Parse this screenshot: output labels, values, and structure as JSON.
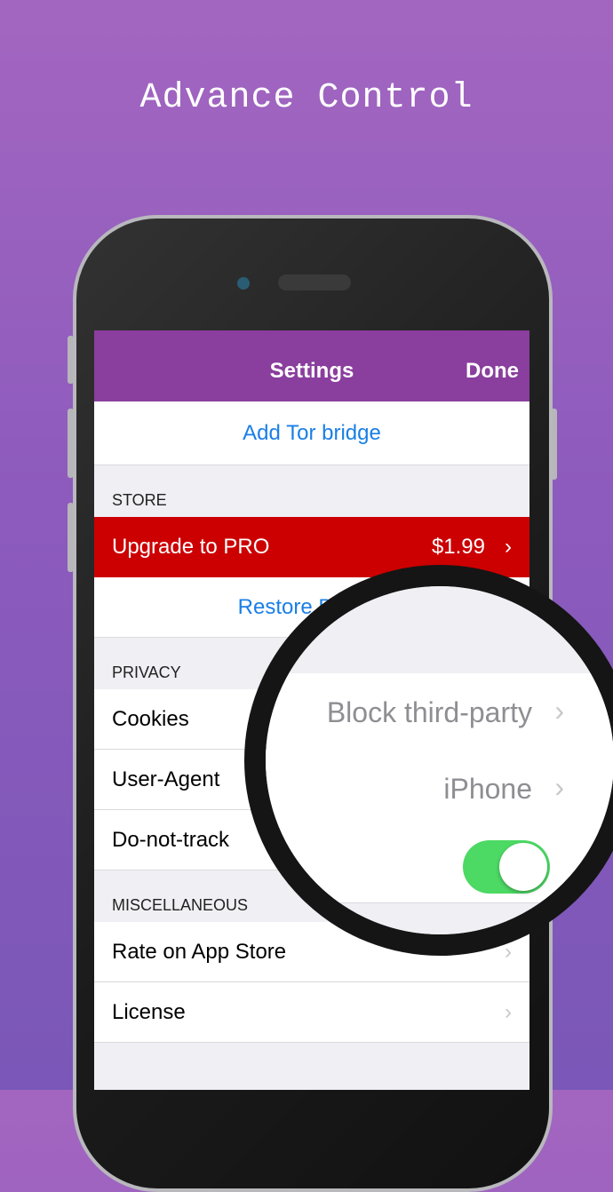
{
  "headline": "Advance Control",
  "nav": {
    "title": "Settings",
    "done": "Done"
  },
  "rows": {
    "add_tor_bridge": "Add Tor bridge",
    "store_header": "STORE",
    "upgrade_label": "Upgrade to PRO",
    "upgrade_price": "$1.99",
    "restore_label": "Restore P",
    "privacy_header": "PRIVACY",
    "cookies_label": "Cookies",
    "user_agent_label": "User-Agent",
    "dnt_label": "Do-not-track",
    "misc_header": "MISCELLANEOUS",
    "rate_label": "Rate on App Store",
    "license_label": "License"
  },
  "magnifier": {
    "cookies_value": "Block third-party",
    "user_agent_value": "iPhone",
    "dnt_enabled": true
  },
  "icons": {
    "chevron": "chevron-right-icon",
    "toggle": "toggle-switch"
  },
  "colors": {
    "nav": "#8a3e9d",
    "upgrade": "#cc0000",
    "link": "#1a7fe6",
    "toggle_on": "#4cd964"
  }
}
